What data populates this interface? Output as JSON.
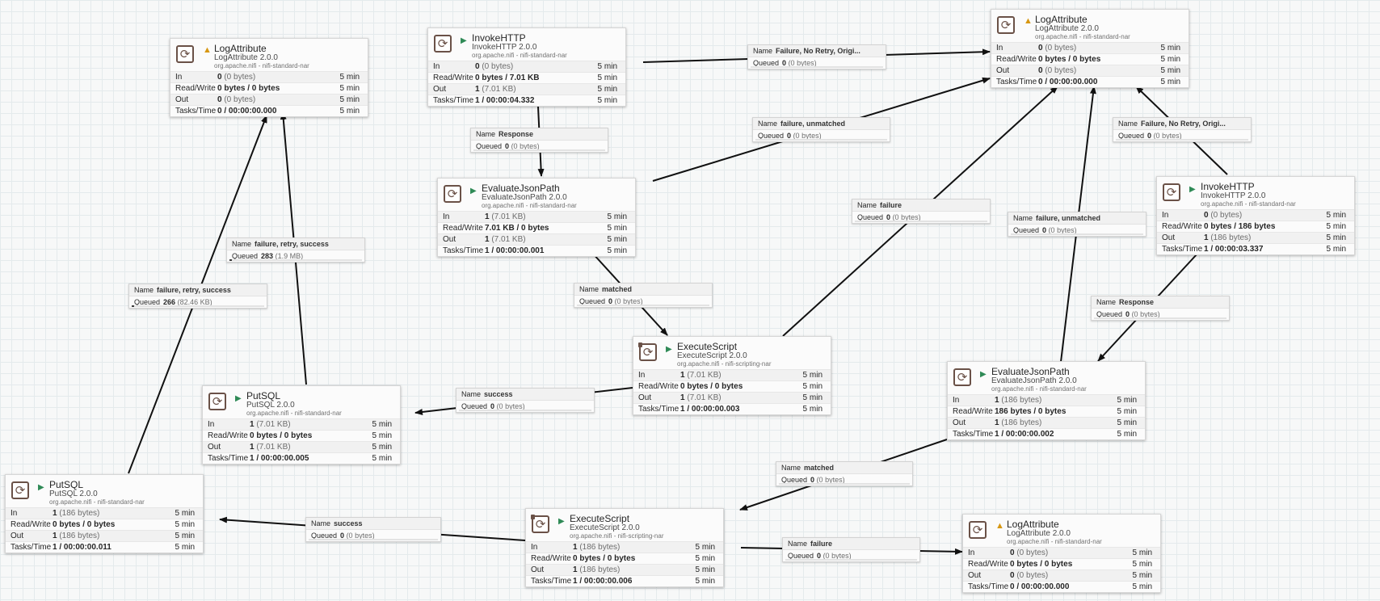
{
  "icons": {
    "processor": "processor-icon",
    "script": "script-processor-icon",
    "running": "play-icon",
    "invalid": "warning-icon"
  },
  "colors": {
    "running": "#2f8a56",
    "warning": "#d79712",
    "edge": "#111111",
    "canvas": "#f7f8f8",
    "grid": "#e4eaec"
  },
  "labels": {
    "in": "In",
    "read_write": "Read/Write",
    "out": "Out",
    "tasks_time": "Tasks/Time",
    "name": "Name",
    "queued": "Queued"
  },
  "processors": [
    {
      "id": "log1",
      "title": "LogAttribute",
      "type": "LogAttribute 2.0.0",
      "bundle": "org.apache.nifi - nifi-standard-nar",
      "status": "invalid",
      "icon": "processor",
      "in": [
        "0",
        "(0 bytes)"
      ],
      "rw": "0 bytes / 0 bytes",
      "out": [
        "0",
        "(0 bytes)"
      ],
      "tasks": "0 / 00:00:00.000",
      "window": "5 min"
    },
    {
      "id": "http1",
      "title": "InvokeHTTP",
      "type": "InvokeHTTP 2.0.0",
      "bundle": "org.apache.nifi - nifi-standard-nar",
      "status": "running",
      "icon": "processor",
      "in": [
        "0",
        "(0 bytes)"
      ],
      "rw": "0 bytes / 7.01 KB",
      "out": [
        "1",
        "(7.01 KB)"
      ],
      "tasks": "1 / 00:00:04.332",
      "window": "5 min"
    },
    {
      "id": "log2",
      "title": "LogAttribute",
      "type": "LogAttribute 2.0.0",
      "bundle": "org.apache.nifi - nifi-standard-nar",
      "status": "invalid",
      "icon": "processor",
      "in": [
        "0",
        "(0 bytes)"
      ],
      "rw": "0 bytes / 0 bytes",
      "out": [
        "0",
        "(0 bytes)"
      ],
      "tasks": "0 / 00:00:00.000",
      "window": "5 min"
    },
    {
      "id": "eval1",
      "title": "EvaluateJsonPath",
      "type": "EvaluateJsonPath 2.0.0",
      "bundle": "org.apache.nifi - nifi-standard-nar",
      "status": "running",
      "icon": "processor",
      "in": [
        "1",
        "(7.01 KB)"
      ],
      "rw": "7.01 KB / 0 bytes",
      "out": [
        "1",
        "(7.01 KB)"
      ],
      "tasks": "1 / 00:00:00.001",
      "window": "5 min"
    },
    {
      "id": "http2",
      "title": "InvokeHTTP",
      "type": "InvokeHTTP 2.0.0",
      "bundle": "org.apache.nifi - nifi-standard-nar",
      "status": "running",
      "icon": "processor",
      "in": [
        "0",
        "(0 bytes)"
      ],
      "rw": "0 bytes / 186 bytes",
      "out": [
        "1",
        "(186 bytes)"
      ],
      "tasks": "1 / 00:00:03.337",
      "window": "5 min"
    },
    {
      "id": "script1",
      "title": "ExecuteScript",
      "type": "ExecuteScript 2.0.0",
      "bundle": "org.apache.nifi - nifi-scripting-nar",
      "status": "running",
      "icon": "script",
      "in": [
        "1",
        "(7.01 KB)"
      ],
      "rw": "0 bytes / 0 bytes",
      "out": [
        "1",
        "(7.01 KB)"
      ],
      "tasks": "1 / 00:00:00.003",
      "window": "5 min"
    },
    {
      "id": "putsql1",
      "title": "PutSQL",
      "type": "PutSQL 2.0.0",
      "bundle": "org.apache.nifi - nifi-standard-nar",
      "status": "running",
      "icon": "processor",
      "in": [
        "1",
        "(7.01 KB)"
      ],
      "rw": "0 bytes / 0 bytes",
      "out": [
        "1",
        "(7.01 KB)"
      ],
      "tasks": "1 / 00:00:00.005",
      "window": "5 min"
    },
    {
      "id": "eval2",
      "title": "EvaluateJsonPath",
      "type": "EvaluateJsonPath 2.0.0",
      "bundle": "org.apache.nifi - nifi-standard-nar",
      "status": "running",
      "icon": "processor",
      "in": [
        "1",
        "(186 bytes)"
      ],
      "rw": "186 bytes / 0 bytes",
      "out": [
        "1",
        "(186 bytes)"
      ],
      "tasks": "1 / 00:00:00.002",
      "window": "5 min"
    },
    {
      "id": "putsql2",
      "title": "PutSQL",
      "type": "PutSQL 2.0.0",
      "bundle": "org.apache.nifi - nifi-standard-nar",
      "status": "running",
      "icon": "processor",
      "in": [
        "1",
        "(186 bytes)"
      ],
      "rw": "0 bytes / 0 bytes",
      "out": [
        "1",
        "(186 bytes)"
      ],
      "tasks": "1 / 00:00:00.011",
      "window": "5 min"
    },
    {
      "id": "script2",
      "title": "ExecuteScript",
      "type": "ExecuteScript 2.0.0",
      "bundle": "org.apache.nifi - nifi-scripting-nar",
      "status": "running",
      "icon": "script",
      "in": [
        "1",
        "(186 bytes)"
      ],
      "rw": "0 bytes / 0 bytes",
      "out": [
        "1",
        "(186 bytes)"
      ],
      "tasks": "1 / 00:00:00.006",
      "window": "5 min"
    },
    {
      "id": "log3",
      "title": "LogAttribute",
      "type": "LogAttribute 2.0.0",
      "bundle": "org.apache.nifi - nifi-standard-nar",
      "status": "invalid",
      "icon": "processor",
      "in": [
        "0",
        "(0 bytes)"
      ],
      "rw": "0 bytes / 0 bytes",
      "out": [
        "0",
        "(0 bytes)"
      ],
      "tasks": "0 / 00:00:00.000",
      "window": "5 min"
    }
  ],
  "connections": [
    {
      "id": "c1",
      "name": "Failure, No Retry, Origi...",
      "queued": "0",
      "queued_size": "(0 bytes)",
      "fill": 0
    },
    {
      "id": "c2",
      "name": "Response",
      "queued": "0",
      "queued_size": "(0 bytes)",
      "fill": 0
    },
    {
      "id": "c3",
      "name": "failure, unmatched",
      "queued": "0",
      "queued_size": "(0 bytes)",
      "fill": 0
    },
    {
      "id": "c4",
      "name": "Failure, No Retry, Origi...",
      "queued": "0",
      "queued_size": "(0 bytes)",
      "fill": 0
    },
    {
      "id": "c5",
      "name": "failure, retry, success",
      "queued": "283",
      "queued_size": "(1.9 MB)",
      "fill": 0.02
    },
    {
      "id": "c6",
      "name": "failure",
      "queued": "0",
      "queued_size": "(0 bytes)",
      "fill": 0
    },
    {
      "id": "c7",
      "name": "failure, unmatched",
      "queued": "0",
      "queued_size": "(0 bytes)",
      "fill": 0
    },
    {
      "id": "c8",
      "name": "failure, retry, success",
      "queued": "266",
      "queued_size": "(82.46 KB)",
      "fill": 0.02
    },
    {
      "id": "c9",
      "name": "matched",
      "queued": "0",
      "queued_size": "(0 bytes)",
      "fill": 0
    },
    {
      "id": "c10",
      "name": "Response",
      "queued": "0",
      "queued_size": "(0 bytes)",
      "fill": 0
    },
    {
      "id": "c11",
      "name": "success",
      "queued": "0",
      "queued_size": "(0 bytes)",
      "fill": 0
    },
    {
      "id": "c12",
      "name": "matched",
      "queued": "0",
      "queued_size": "(0 bytes)",
      "fill": 0
    },
    {
      "id": "c13",
      "name": "success",
      "queued": "0",
      "queued_size": "(0 bytes)",
      "fill": 0
    },
    {
      "id": "c14",
      "name": "failure",
      "queued": "0",
      "queued_size": "(0 bytes)",
      "fill": 0
    }
  ]
}
